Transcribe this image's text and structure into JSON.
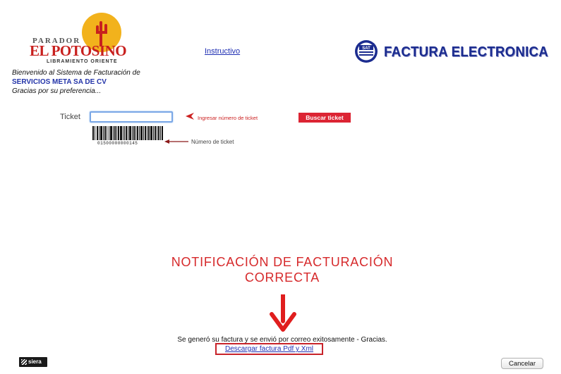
{
  "header": {
    "logo": {
      "top_text": "PARADOR",
      "brand": "EL POTOSINO",
      "subtitle": "LIBRAMIENTO ORIENTE",
      "colors": {
        "sun": "#f2b21c",
        "brand": "#c8201e"
      }
    },
    "instructivo_link": "Instructivo",
    "sat_badge": {
      "icon": "sat-seal-icon",
      "text": "SAT"
    },
    "factura_title": "FACTURA ELECTRONICA"
  },
  "welcome": {
    "line1": "Bienvenido al Sistema de Facturación de",
    "company": "SERVICIOS META SA DE CV",
    "thanks": "Gracias por su preferencia..."
  },
  "ticket_form": {
    "label": "Ticket",
    "input_value": "",
    "hint": "Ingresar número de ticket",
    "search_button": "Buscar ticket",
    "barcode_number": "01500000000145",
    "barcode_label": "Número de ticket"
  },
  "notification": {
    "line1": "NOTIFICACIÓN DE FACTURACIÓN",
    "line2": "CORRECTA",
    "color": "#d6292b"
  },
  "result": {
    "message": "Se generó su factura y se envió por correo exitosamente - Gracias.",
    "download_link": "Descargar factura Pdf y Xml"
  },
  "footer": {
    "siera_logo": "siera",
    "cancel_button": "Cancelar"
  }
}
